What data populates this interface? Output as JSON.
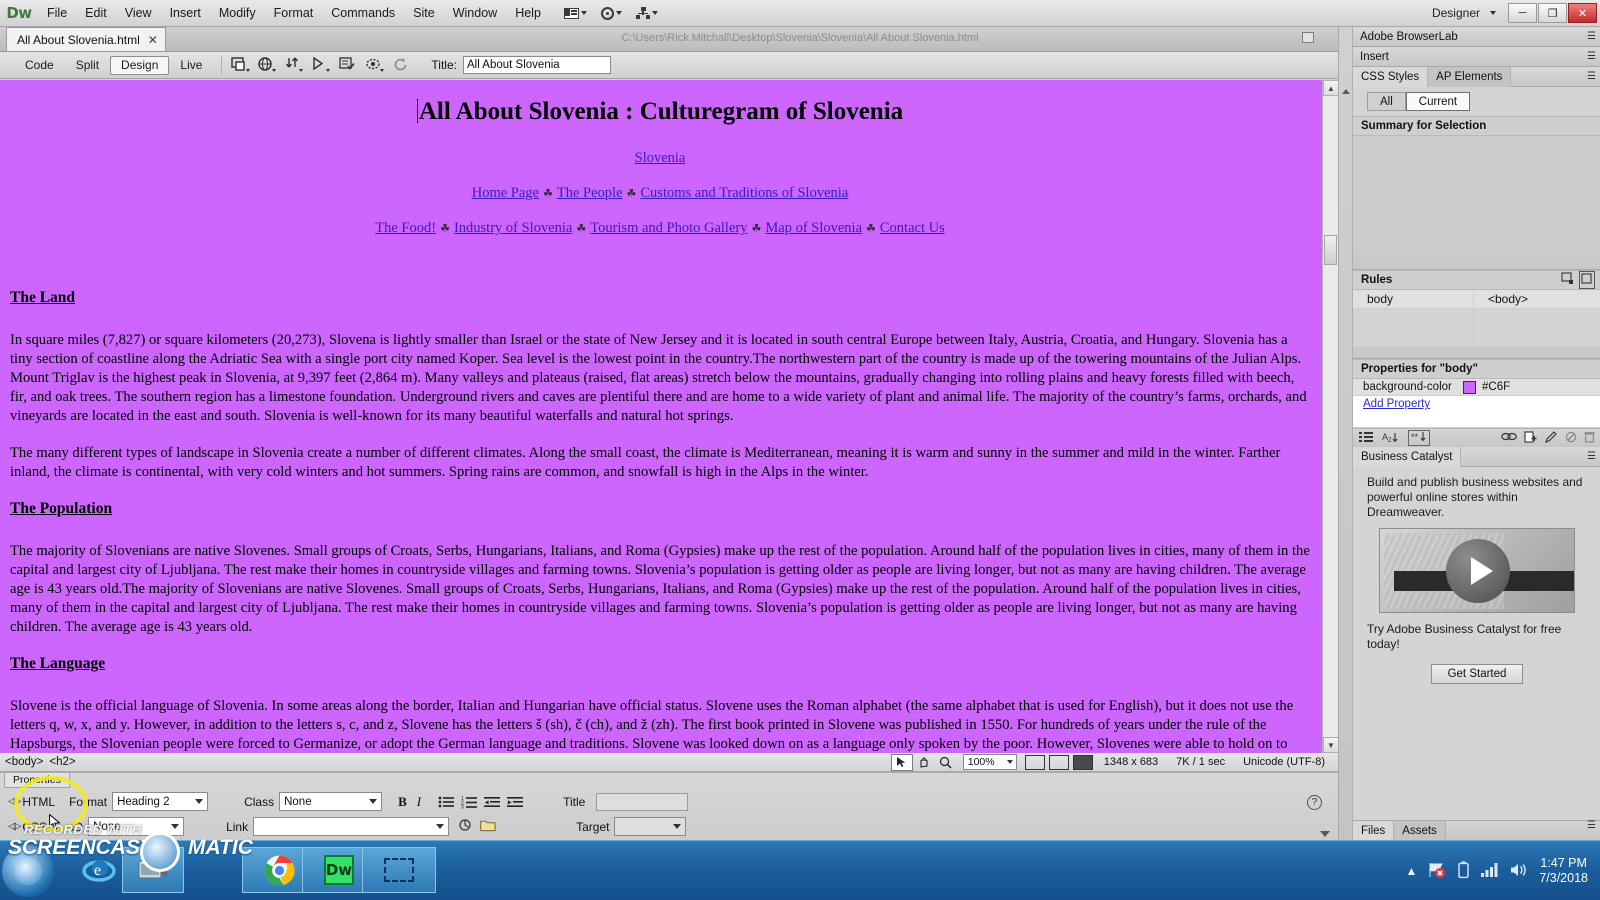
{
  "app": {
    "name": "Dw",
    "workspace": "Designer",
    "menu": [
      "File",
      "Edit",
      "View",
      "Insert",
      "Modify",
      "Format",
      "Commands",
      "Site",
      "Window",
      "Help"
    ],
    "window_controls": {
      "minimize": "─",
      "maximize": "❐",
      "close": "✕"
    }
  },
  "doctab": {
    "filename": "All About Slovenia.html",
    "close": "✕",
    "path": "C:\\Users\\Rick.Mitchall\\Desktop\\Slovenia\\Slovenia\\All About Slovenia.html"
  },
  "toolbar": {
    "views": [
      {
        "label": "Code",
        "active": false
      },
      {
        "label": "Split",
        "active": false
      },
      {
        "label": "Design",
        "active": true
      },
      {
        "label": "Live",
        "active": false
      }
    ],
    "title_label": "Title:",
    "title_value": "All About Slovenia"
  },
  "document": {
    "background_color": "#CC66FF",
    "heading": "All About Slovenia : Culturegram of Slovenia",
    "country_link": "Slovenia",
    "nav_row1": [
      "Home Page",
      "The People",
      "Customs and Traditions of Slovenia"
    ],
    "nav_row2": [
      "The Food!",
      "Industry of Slovenia",
      "Tourism and Photo Gallery",
      "Map of Slovenia",
      "Contact Us"
    ],
    "nav_separator": "☘",
    "sections": [
      {
        "heading": "The Land",
        "paragraphs": [
          "In square miles (7,827) or square kilometers (20,273), Slovena is lightly smaller than Israel or the state of New Jersey and it is located in south central Europe between Italy, Austria, Croatia, and Hungary. Slovenia has a tiny section of coastline along the Adriatic Sea with a single port city named Koper. Sea level is the lowest point in the country.The northwestern part of the country is made up of the towering mountains of the Julian Alps. Mount Triglav is the highest peak in Slovenia, at 9,397 feet (2,864 m). Many valleys and plateaus (raised, flat areas) stretch below the mountains, gradually changing into rolling plains and heavy forests filled with beech, fir, and oak trees. The southern region has a limestone foundation. Underground rivers and caves are plentiful there and are home to a wide variety of plant and animal life. The majority of the country’s farms, orchards, and vineyards are located in the east and south. Slovenia is well-known for its many beautiful waterfalls and natural hot springs.",
          "The many different types of landscape in Slovenia create a number of different climates. Along the small coast, the climate is Mediterranean, meaning it is warm and sunny in the summer and mild in the winter. Farther inland, the climate is continental, with very cold winters and hot summers. Spring rains are common, and snowfall is high in the Alps in the winter."
        ]
      },
      {
        "heading": "The Population",
        "paragraphs": [
          "The majority of Slovenians are native Slovenes. Small groups of Croats, Serbs, Hungarians, Italians, and Roma (Gypsies) make up the rest of the population. Around half of the population lives in cities, many of them in the capital and largest city of Ljubljana. The rest make their homes in countryside villages and farming towns. Slovenia’s population is getting older as people are living longer, but not as many are having children. The average age is 43 years old.The majority of Slovenians are native Slovenes. Small groups of Croats, Serbs, Hungarians, Italians, and Roma (Gypsies) make up the rest of the population. Around half of the population lives in cities, many of them in the capital and largest city of Ljubljana. The rest make their homes in countryside villages and farming towns. Slovenia’s population is getting older as people are living longer, but not as many are having children. The average age is 43 years old."
        ]
      },
      {
        "heading": "The Language",
        "paragraphs": [
          "Slovene is the official language of Slovenia. In some areas along the border, Italian and Hungarian have official status. Slovene uses the Roman alphabet (the same alphabet that is used for English), but it does not use the letters q, w, x, and y. However, in addition to the letters s, c, and z, Slovene has the letters š (sh), č (ch), and ž (zh). The first book printed in Slovene was published in 1550. For hundreds of years under the rule of the Hapsburgs, the Slovenian people were forced to Germanize, or adopt the German language and traditions. Slovene was looked down on as a language only spoken by the poor. However, Slovenes were able to hold on to their native language and culture. Today, most Slovenes are bilingual (able to speak two languages). English, German, Italian, French, Croatian, and Serbian are the most common second languages."
        ]
      }
    ]
  },
  "statusbar": {
    "tag_selector": [
      "<body>",
      "<h2>"
    ],
    "zoom": "100%",
    "window_size": "1348 x 683",
    "download": "7K / 1 sec",
    "encoding": "Unicode (UTF-8)"
  },
  "properties": {
    "panel_title": "Properties",
    "html_button": "HTML",
    "css_button": "CSS",
    "format_label": "Format",
    "format_value": "Heading 2",
    "class_label": "Class",
    "class_value": "None",
    "id_label": "ID",
    "id_value": "None",
    "link_label": "Link",
    "link_value": "",
    "title_label": "Title",
    "title_value": "",
    "target_label": "Target",
    "target_value": "",
    "bold": "B",
    "italic": "I"
  },
  "dock": {
    "browserlab_title": "Adobe BrowserLab",
    "insert_title": "Insert",
    "css_tabs": [
      {
        "label": "CSS Styles",
        "active": true
      },
      {
        "label": "AP Elements",
        "active": false
      }
    ],
    "segments": [
      {
        "label": "All",
        "active": false
      },
      {
        "label": "Current",
        "active": true
      }
    ],
    "summary_title": "Summary for Selection",
    "rules_title": "Rules",
    "rules": [
      {
        "selector": "body",
        "applies": "<body>"
      }
    ],
    "properties_title": "Properties for \"body\"",
    "property_rows": [
      {
        "name": "background-color",
        "value": "#C6F",
        "swatch": "#CC66FF"
      }
    ],
    "add_property": "Add Property",
    "bc_tab": "Business Catalyst",
    "bc_text": "Build and publish business websites and powerful online stores within Dreamweaver.",
    "bc_cta": "Try Adobe Business Catalyst for free today!",
    "bc_button": "Get Started",
    "bottom_tabs": [
      {
        "label": "Files",
        "active": true
      },
      {
        "label": "Assets",
        "active": false
      }
    ]
  },
  "taskbar": {
    "watermark_top": "RECORDED WITH",
    "watermark_main": "SCREENCAST",
    "watermark_main2": "MATIC",
    "clock_time": "1:47 PM",
    "clock_date": "7/3/2018",
    "apps": [
      "ie-icon",
      "screencast-icon",
      "chrome-icon",
      "dreamweaver-icon",
      "snip-icon"
    ]
  }
}
